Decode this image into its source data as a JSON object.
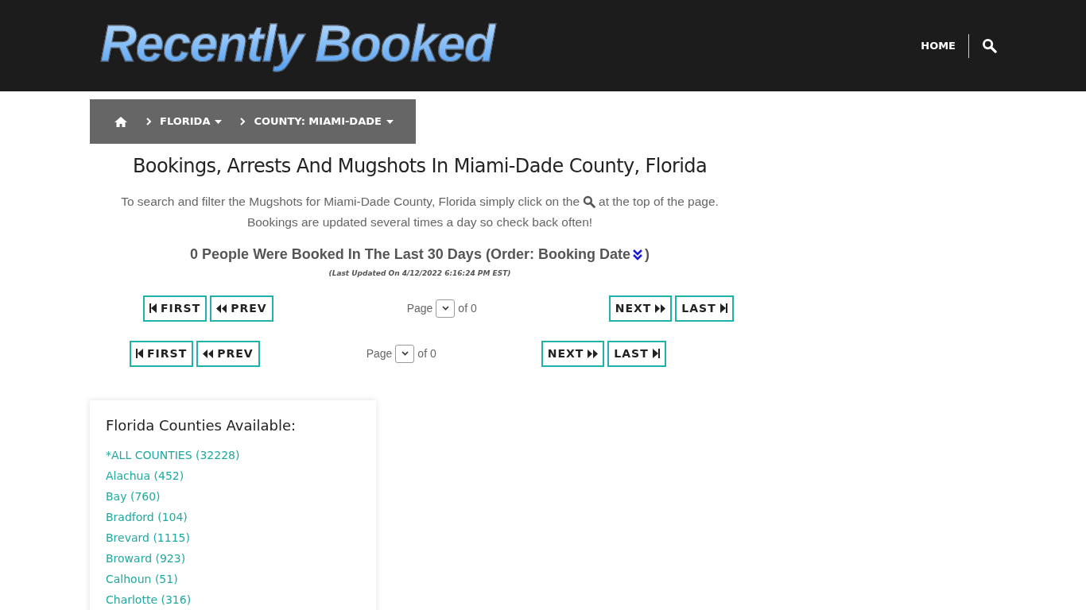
{
  "header": {
    "logo": "Recently Booked",
    "nav": [
      {
        "label": "HOME"
      }
    ]
  },
  "breadcrumb": [
    {
      "label": "FLORIDA",
      "dropdown": true
    },
    {
      "label": "COUNTY: MIAMI-DADE",
      "dropdown": true
    }
  ],
  "title": "Bookings, Arrests And Mugshots In Miami-Dade County, Florida",
  "intro": {
    "before_icon": "To search and filter the Mugshots for Miami-Dade County, Florida simply click on the",
    "after_icon": "at the top of the page.",
    "line_2": "Bookings are updated several times a day so check back often!"
  },
  "summary": {
    "text": "0 People Were Booked In The Last 30 Days (Order: Booking Date",
    "close": ")"
  },
  "updated": "(Last Updated On 4/12/2022 6:16:24 PM EST)",
  "pagers": [
    {
      "buttons": [
        {
          "kind": "first",
          "label": "FIRST"
        },
        {
          "kind": "prev",
          "label": "PREV"
        },
        {
          "kind": "next",
          "label": "NEXT"
        },
        {
          "kind": "last",
          "label": "LAST"
        }
      ],
      "page_label": "Page",
      "of_label": "of 0"
    },
    {
      "buttons": [
        {
          "kind": "first",
          "label": "FIRST"
        },
        {
          "kind": "prev",
          "label": "PREV"
        },
        {
          "kind": "next",
          "label": "NEXT"
        },
        {
          "kind": "last",
          "label": "LAST"
        }
      ],
      "page_label": "Page",
      "of_label": "of 0"
    }
  ],
  "counties": {
    "title": "Florida Counties Available:",
    "items": [
      {
        "label": "*ALL COUNTIES (32228)"
      },
      {
        "label": "Alachua (452)"
      },
      {
        "label": "Bay (760)"
      },
      {
        "label": "Bradford (104)"
      },
      {
        "label": "Brevard (1115)"
      },
      {
        "label": "Broward (923)"
      },
      {
        "label": "Calhoun (51)"
      },
      {
        "label": "Charlotte (316)"
      }
    ]
  }
}
